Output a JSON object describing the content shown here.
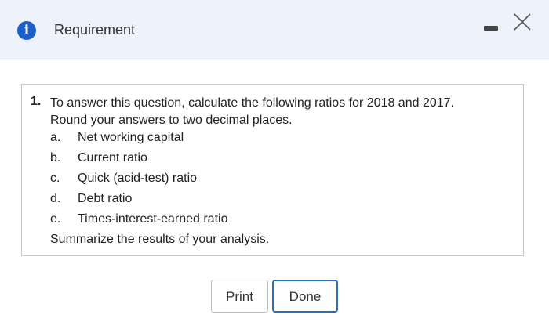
{
  "header": {
    "title": "Requirement",
    "info_icon_glyph": "i"
  },
  "content": {
    "number": "1.",
    "question_line1": "To answer this question, calculate the following ratios for 2018 and 2017.",
    "question_line2": "Round your answers to two decimal places.",
    "items": [
      {
        "letter": "a.",
        "text": "Net working capital"
      },
      {
        "letter": "b.",
        "text": "Current ratio"
      },
      {
        "letter": "c.",
        "text": "Quick (acid-test) ratio"
      },
      {
        "letter": "d.",
        "text": "Debt ratio"
      },
      {
        "letter": "e.",
        "text": "Times-interest-earned ratio"
      }
    ],
    "summary": "Summarize the results of your analysis."
  },
  "buttons": {
    "print_label": "Print",
    "done_label": "Done"
  },
  "colors": {
    "header_bg": "#eef3fb",
    "info_icon": "#1d5fc9",
    "done_border": "#2a6ebc"
  }
}
